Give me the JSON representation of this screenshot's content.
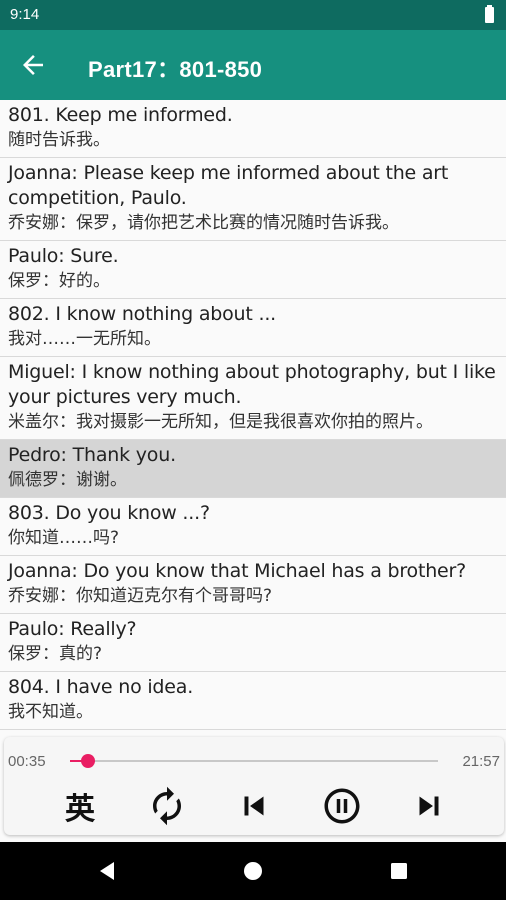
{
  "status_bar": {
    "time": "9:14"
  },
  "app_bar": {
    "title": "Part17：801-850"
  },
  "entries": [
    {
      "en": "801. Keep me informed.",
      "zh": "随时告诉我。"
    },
    {
      "en": "Joanna: Please keep me informed about the art competition, Paulo.",
      "zh": "乔安娜：保罗，请你把艺术比赛的情况随时告诉我。"
    },
    {
      "en": "Paulo: Sure.",
      "zh": "保罗：好的。"
    },
    {
      "en": "802. I know nothing about ...",
      "zh": "我对……一无所知。"
    },
    {
      "en": "Miguel: I know nothing about photography, but I like your pictures very much.",
      "zh": "米盖尔：我对摄影一无所知，但是我很喜欢你拍的照片。"
    },
    {
      "en": "Pedro: Thank you.",
      "zh": "佩德罗：谢谢。"
    },
    {
      "en": "803. Do you know ...?",
      "zh": "你知道……吗?"
    },
    {
      "en": "Joanna: Do you know that Michael has a brother?",
      "zh": "乔安娜：你知道迈克尔有个哥哥吗?"
    },
    {
      "en": "Paulo: Really?",
      "zh": "保罗：真的?"
    },
    {
      "en": "804. I have no idea.",
      "zh": "我不知道。"
    }
  ],
  "player": {
    "current_time": "00:35",
    "total_time": "21:57",
    "progress": 0.05,
    "lang_label": "英",
    "accent_color": "#e91e63"
  },
  "colors": {
    "app_bar": "#16907f",
    "status_bar": "#0e6b60",
    "highlight": "#d5d5d5"
  }
}
